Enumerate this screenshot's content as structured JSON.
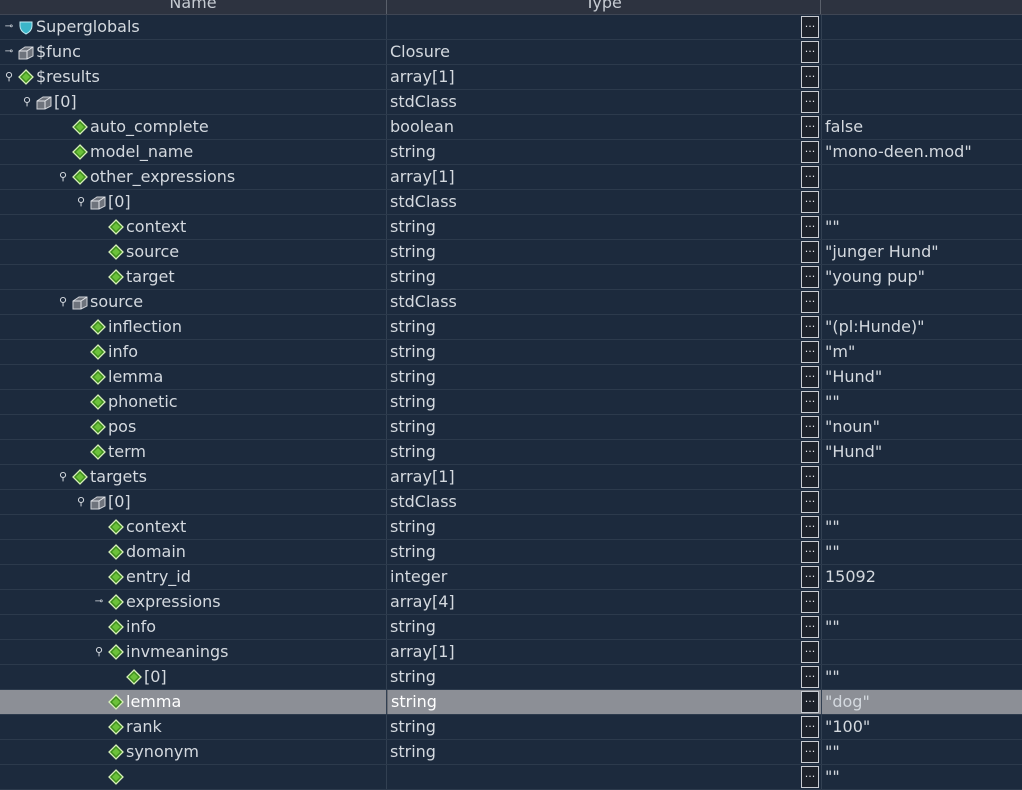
{
  "columns": {
    "name": "Name",
    "type": "Type"
  },
  "button_label": "...",
  "rows": [
    {
      "name": "Superglobals",
      "type": "",
      "value": "",
      "level": 0,
      "icon": "shield-icon",
      "toggle": "collapsed"
    },
    {
      "name": "$func",
      "type": "Closure",
      "value": "",
      "level": 0,
      "icon": "object-icon",
      "toggle": "collapsed"
    },
    {
      "name": "$results",
      "type": "array[1]",
      "value": "",
      "level": 0,
      "icon": "diamond-icon",
      "toggle": "expanded"
    },
    {
      "name": "[0]",
      "type": "stdClass",
      "value": "",
      "level": 1,
      "icon": "object-icon",
      "toggle": "expanded"
    },
    {
      "name": "auto_complete",
      "type": "boolean",
      "value": "false",
      "level": 3,
      "icon": "diamond-icon",
      "toggle": "none"
    },
    {
      "name": "model_name",
      "type": "string",
      "value": "\"mono-deen.mod\"",
      "level": 3,
      "icon": "diamond-icon",
      "toggle": "none"
    },
    {
      "name": "other_expressions",
      "type": "array[1]",
      "value": "",
      "level": 3,
      "icon": "diamond-icon",
      "toggle": "expanded"
    },
    {
      "name": "[0]",
      "type": "stdClass",
      "value": "",
      "level": 4,
      "icon": "object-icon",
      "toggle": "expanded"
    },
    {
      "name": "context",
      "type": "string",
      "value": "\"\"",
      "level": 5,
      "icon": "diamond-icon",
      "toggle": "none"
    },
    {
      "name": "source",
      "type": "string",
      "value": "\"junger Hund\"",
      "level": 5,
      "icon": "diamond-icon",
      "toggle": "none"
    },
    {
      "name": "target",
      "type": "string",
      "value": "\"young pup\"",
      "level": 5,
      "icon": "diamond-icon",
      "toggle": "none"
    },
    {
      "name": "source",
      "type": "stdClass",
      "value": "",
      "level": 3,
      "icon": "object-icon",
      "toggle": "expanded"
    },
    {
      "name": "inflection",
      "type": "string",
      "value": "\"(pl:Hunde)\"",
      "level": 4,
      "icon": "diamond-icon",
      "toggle": "none"
    },
    {
      "name": "info",
      "type": "string",
      "value": "\"m\"",
      "level": 4,
      "icon": "diamond-icon",
      "toggle": "none"
    },
    {
      "name": "lemma",
      "type": "string",
      "value": "\"Hund\"",
      "level": 4,
      "icon": "diamond-icon",
      "toggle": "none"
    },
    {
      "name": "phonetic",
      "type": "string",
      "value": "\"\"",
      "level": 4,
      "icon": "diamond-icon",
      "toggle": "none"
    },
    {
      "name": "pos",
      "type": "string",
      "value": "\"noun\"",
      "level": 4,
      "icon": "diamond-icon",
      "toggle": "none"
    },
    {
      "name": "term",
      "type": "string",
      "value": "\"Hund\"",
      "level": 4,
      "icon": "diamond-icon",
      "toggle": "none"
    },
    {
      "name": "targets",
      "type": "array[1]",
      "value": "",
      "level": 3,
      "icon": "diamond-icon",
      "toggle": "expanded"
    },
    {
      "name": "[0]",
      "type": "stdClass",
      "value": "",
      "level": 4,
      "icon": "object-icon",
      "toggle": "expanded"
    },
    {
      "name": "context",
      "type": "string",
      "value": "\"\"",
      "level": 5,
      "icon": "diamond-icon",
      "toggle": "none"
    },
    {
      "name": "domain",
      "type": "string",
      "value": "\"\"",
      "level": 5,
      "icon": "diamond-icon",
      "toggle": "none"
    },
    {
      "name": "entry_id",
      "type": "integer",
      "value": "15092",
      "level": 5,
      "icon": "diamond-icon",
      "toggle": "none"
    },
    {
      "name": "expressions",
      "type": "array[4]",
      "value": "",
      "level": 5,
      "icon": "diamond-icon",
      "toggle": "collapsed"
    },
    {
      "name": "info",
      "type": "string",
      "value": "\"\"",
      "level": 5,
      "icon": "diamond-icon",
      "toggle": "none"
    },
    {
      "name": "invmeanings",
      "type": "array[1]",
      "value": "",
      "level": 5,
      "icon": "diamond-icon",
      "toggle": "expanded"
    },
    {
      "name": "[0]",
      "type": "string",
      "value": "\"\"",
      "level": 6,
      "icon": "diamond-icon",
      "toggle": "none"
    },
    {
      "name": "lemma",
      "type": "string",
      "value": "\"dog\"",
      "level": 5,
      "icon": "diamond-icon",
      "toggle": "none",
      "selected": true
    },
    {
      "name": "rank",
      "type": "string",
      "value": "\"100\"",
      "level": 5,
      "icon": "diamond-icon",
      "toggle": "none"
    },
    {
      "name": "synonym",
      "type": "string",
      "value": "\"\"",
      "level": 5,
      "icon": "diamond-icon",
      "toggle": "none"
    },
    {
      "name": "",
      "type": "",
      "value": "\"\"",
      "level": 5,
      "icon": "diamond-icon",
      "toggle": "none"
    }
  ]
}
